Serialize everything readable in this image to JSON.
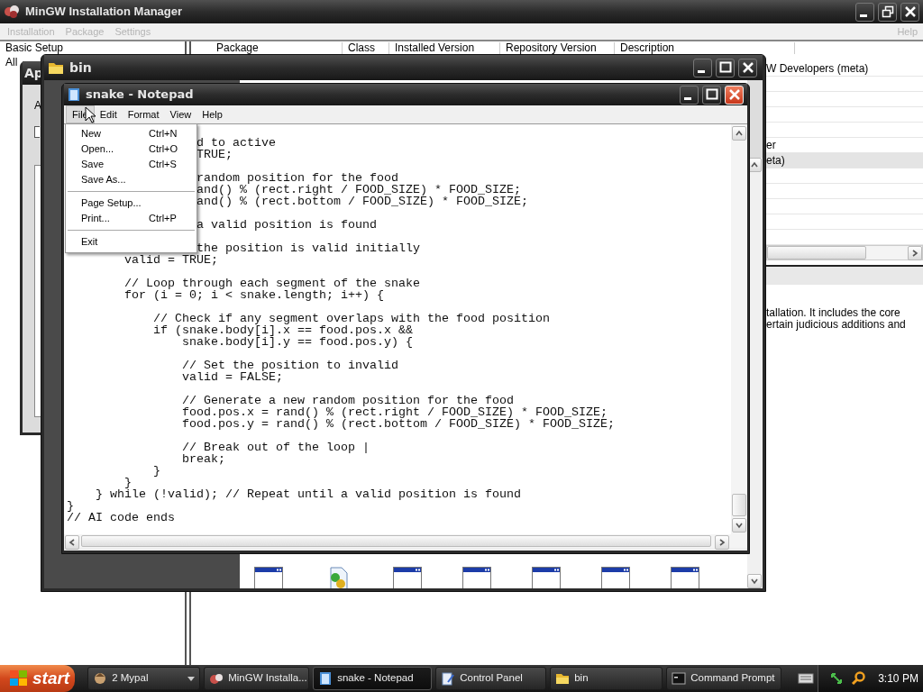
{
  "installer": {
    "title": "MinGW Installation Manager",
    "menu": [
      {
        "label": "Installation",
        "disabled": true
      },
      {
        "label": "Package",
        "disabled": true
      },
      {
        "label": "Settings",
        "disabled": true
      }
    ],
    "help": {
      "label": "Help",
      "disabled": true
    },
    "sidebar": [
      {
        "label": "Basic Setup",
        "selected": false
      },
      {
        "label": "All",
        "selected": false
      }
    ],
    "columns": [
      "Package",
      "Class",
      "Installed Version",
      "Repository Version",
      "Description"
    ],
    "rows": [
      {
        "description": "W Developers (meta)",
        "selected": false
      },
      {
        "selected": false
      },
      {
        "selected": false
      },
      {
        "selected": false
      },
      {
        "selected": false
      },
      {
        "description": "er",
        "selected": false
      },
      {
        "description": "eta)",
        "selected": true
      },
      {
        "selected": false
      },
      {
        "selected": false
      },
      {
        "selected": false
      },
      {
        "selected": false
      },
      {
        "selected": false
      }
    ],
    "details": [
      "tallation. It includes the core",
      "ertain judicious additions and"
    ]
  },
  "app_window": {
    "title": "Ap",
    "label": "A",
    "checkbox": {
      "checked": false
    }
  },
  "folder_window": {
    "title": "bin",
    "files": [
      {
        "kind": "window"
      },
      {
        "kind": "script"
      },
      {
        "kind": "window"
      },
      {
        "kind": "window"
      },
      {
        "kind": "window"
      },
      {
        "kind": "window"
      },
      {
        "kind": "window"
      }
    ]
  },
  "notepad": {
    "title": "snake - Notepad",
    "menu": [
      {
        "label": "File",
        "selected": true
      },
      {
        "label": "Edit",
        "selected": false
      },
      {
        "label": "Format",
        "selected": false
      },
      {
        "label": "View",
        "selected": false
      },
      {
        "label": "Help",
        "selected": false
      }
    ],
    "blocks": [
      [
        "                  d to active",
        "                  TRUE;"
      ],
      [
        "                  random position for the food",
        "                  and() % (rect.right / FOOD_SIZE) * FOOD_SIZE;",
        "                  and() % (rect.bottom / FOOD_SIZE) * FOOD_SIZE;"
      ],
      [
        "                  a valid position is found"
      ],
      [
        "                  the position is valid initially",
        "        valid = TRUE;"
      ],
      [
        "        // Loop through each segment of the snake",
        "        for (i = 0; i < snake.length; i++) {"
      ],
      [
        "            // Check if any segment overlaps with the food position",
        "            if (snake.body[i].x == food.pos.x &&",
        "                snake.body[i].y == food.pos.y) {"
      ],
      [
        "                // Set the position to invalid",
        "                valid = FALSE;"
      ],
      [
        "                // Generate a new random position for the food",
        "                food.pos.x = rand() % (rect.right / FOOD_SIZE) * FOOD_SIZE;",
        "                food.pos.y = rand() % (rect.bottom / FOOD_SIZE) * FOOD_SIZE;"
      ],
      [
        "                // Break out of the loop |",
        "                break;",
        "            }",
        "        }",
        "    } while (!valid); // Repeat until a valid position is found",
        "}",
        "// AI code ends"
      ]
    ],
    "file_menu": [
      {
        "kind": "item",
        "label": "New",
        "shortcut": "Ctrl+N"
      },
      {
        "kind": "item",
        "label": "Open...",
        "shortcut": "Ctrl+O"
      },
      {
        "kind": "item",
        "label": "Save",
        "shortcut": "Ctrl+S"
      },
      {
        "kind": "item",
        "label": "Save As..."
      },
      {
        "kind": "separator"
      },
      {
        "kind": "item",
        "label": "Page Setup..."
      },
      {
        "kind": "item",
        "label": "Print...",
        "shortcut": "Ctrl+P"
      },
      {
        "kind": "separator"
      },
      {
        "kind": "item",
        "label": "Exit"
      }
    ]
  },
  "taskbar": {
    "start": "start",
    "buttons": [
      {
        "kind": "group",
        "label": "2 Mypal",
        "selected": false
      },
      {
        "kind": "installer",
        "label": "MinGW Installa...",
        "selected": false
      },
      {
        "kind": "notepad",
        "label": "snake - Notepad",
        "selected": true
      },
      {
        "kind": "control",
        "label": "Control Panel",
        "selected": false
      },
      {
        "kind": "folder",
        "label": "bin",
        "selected": false
      },
      {
        "kind": "console",
        "label": "Command Prompt",
        "selected": false
      }
    ],
    "clock": "3:10 PM"
  }
}
